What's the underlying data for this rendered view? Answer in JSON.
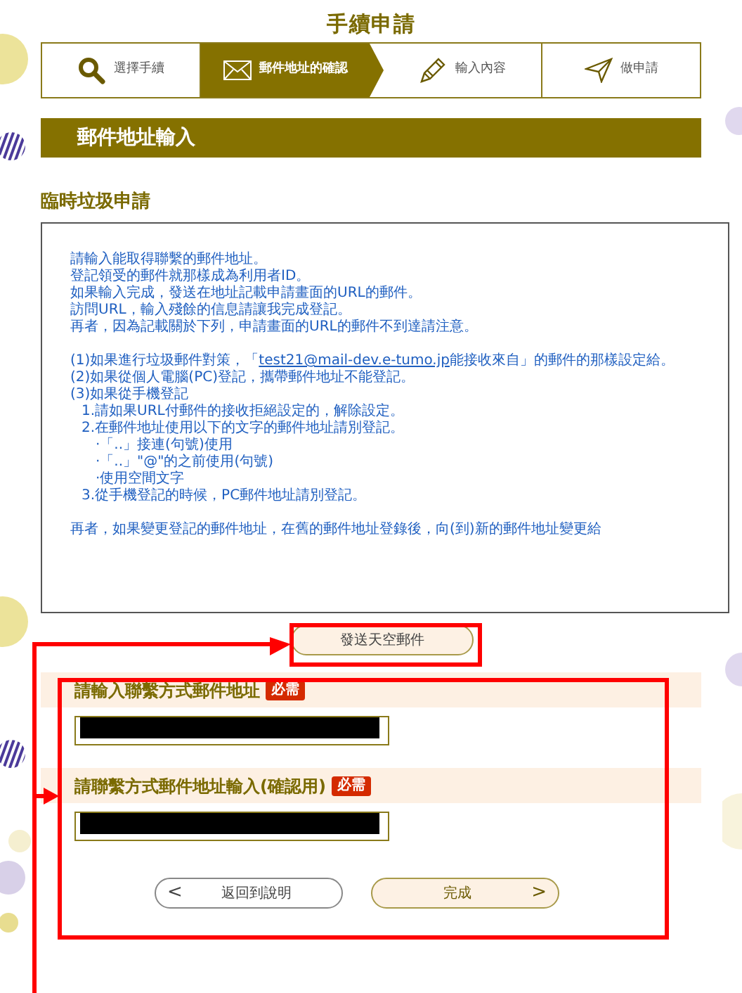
{
  "page_title": "手續申請",
  "steps": [
    {
      "label": "選擇手續",
      "selected": false
    },
    {
      "label": "郵件地址的確認",
      "selected": true
    },
    {
      "label": "輸入內容",
      "selected": false
    },
    {
      "label": "做申請",
      "selected": false
    }
  ],
  "section_header": "郵件地址輸入",
  "subtitle": "臨時垃圾申請",
  "notice": {
    "paragraphs": [
      {
        "lines": [
          {
            "text": "請輸入能取得聯繫的郵件地址。"
          },
          {
            "text": "登記領受的郵件就那樣成為利用者ID。"
          },
          {
            "text": "如果輸入完成，發送在地址記載申請畫面的URL的郵件。"
          },
          {
            "text": "訪問URL，輸入殘餘的信息請讓我完成登記。"
          },
          {
            "text": "再者，因為記載關於下列，申請畫面的URL的郵件不到達請注意。"
          }
        ]
      },
      {
        "lines": [
          {
            "text": "(1)如果進行垃圾郵件對策，「",
            "link": "test21@mail-dev.e-tumo.jp",
            "after": "能接收來自」的郵件的那樣設定給。"
          },
          {
            "text": "(2)如果從個人電腦(PC)登記，攜帶郵件地址不能登記。"
          },
          {
            "text": "(3)如果從手機登記",
            "children": [
              {
                "text": "1.請如果URL付郵件的接收拒絕設定的，解除設定。"
              },
              {
                "text": "2.在郵件地址使用以下的文字的郵件地址請別登記。",
                "children": [
                  {
                    "text": "·「..」接連(句號)使用"
                  },
                  {
                    "text": "·「..」\"@\"的之前使用(句號)"
                  },
                  {
                    "text": "·使用空間文字"
                  }
                ]
              },
              {
                "text": "3.從手機登記的時候，PC郵件地址請別登記。"
              }
            ]
          }
        ]
      },
      {
        "lines": [
          {
            "text": "再者，如果變更登記的郵件地址，在舊的郵件地址登錄後，向(到)新的郵件地址變更給"
          }
        ]
      }
    ]
  },
  "send_button": "發送天空郵件",
  "fields": [
    {
      "label": "請輸入聯繫方式郵件地址",
      "badge": "必需",
      "redacted": true
    },
    {
      "label": "請聯繫方式郵件地址輸入(確認用)",
      "badge": "必需",
      "redacted": true
    }
  ],
  "back_button": {
    "arrow": "<",
    "label": "返回到說明"
  },
  "done_button": {
    "label": "完成",
    "arrow": ">"
  }
}
